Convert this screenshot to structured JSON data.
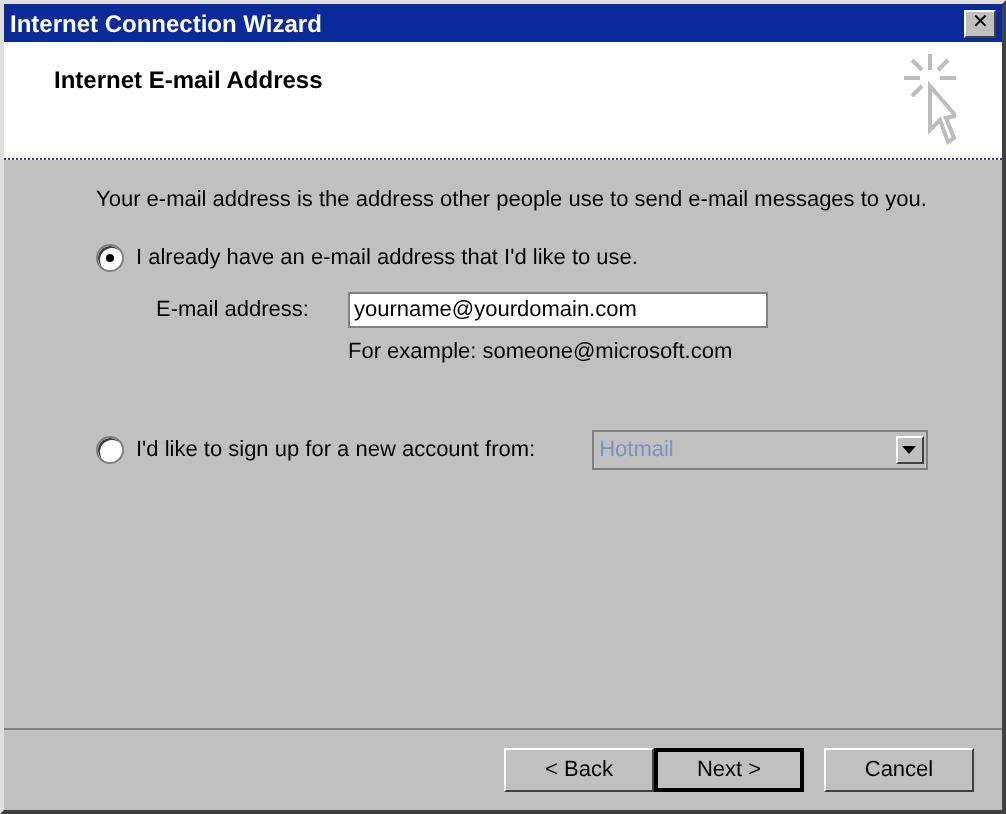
{
  "window": {
    "title": "Internet Connection Wizard",
    "close": "✕"
  },
  "header": {
    "title": "Internet E-mail Address"
  },
  "intro": "Your e-mail address is the address other people use to send e-mail messages to you.",
  "options": [
    {
      "kind": "address",
      "label": "I already have an e-mail address that I'd like to use.",
      "selected": true,
      "field_label": "E-mail address:",
      "value": "yourname@yourdomain.com",
      "hint": "For example: someone@microsoft.com"
    },
    {
      "kind": "signup",
      "label": "I'd like to sign up for a new account from:",
      "selected": false,
      "dropdown": {
        "value": "Hotmail",
        "disabled": true
      }
    }
  ],
  "buttons": [
    {
      "label": "< Back",
      "default": false
    },
    {
      "label": "Next >",
      "default": true
    },
    {
      "label": "Cancel",
      "default": false
    }
  ]
}
